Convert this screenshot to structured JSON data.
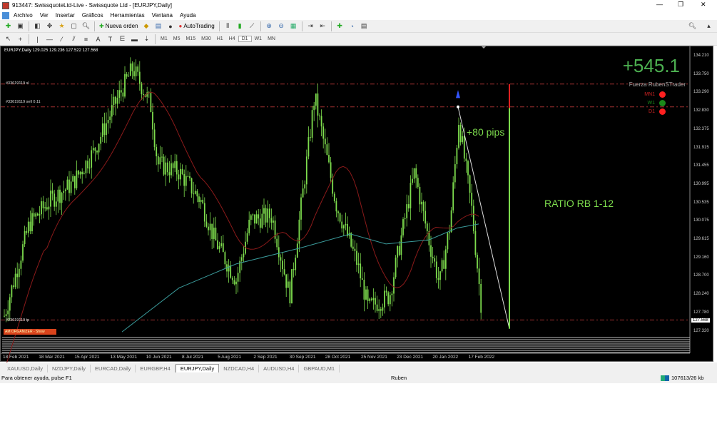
{
  "window": {
    "title": "913447: SwissquoteLtd-Live - Swissquote Ltd - [EURJPY,Daily]",
    "minimize": "—",
    "maximize": "❐",
    "close": "✕"
  },
  "menu": [
    "Archivo",
    "Ver",
    "Insertar",
    "Gráficos",
    "Herramientas",
    "Ventana",
    "Ayuda"
  ],
  "toolbar": {
    "new_order": "Nueva orden",
    "autotrading": "AutoTrading",
    "timeframes": [
      "M1",
      "M5",
      "M15",
      "M30",
      "H1",
      "H4",
      "D1",
      "W1",
      "MN"
    ],
    "active_timeframe": "D1"
  },
  "chart": {
    "symbol_header": "EURJPY,Daily  129.025 129.236 127.522 127.568",
    "levels": {
      "sl": "#33619119 sl",
      "sell": "#33619119 sell 0.11",
      "tp": "#33619119 tp"
    },
    "profit": "+545.1",
    "indicator_title": "Fuerza RubenSTrader",
    "signals": [
      {
        "label": "MN1",
        "color": "#ff2020"
      },
      {
        "label": "W1",
        "color": "#1a8a1a"
      },
      {
        "label": "D1",
        "color": "#ff2020"
      }
    ],
    "pips_label": "+80 pips",
    "ratio_label": "RATIO RB 1-12",
    "organizer": "AM ORGANIZER - Show",
    "price_ticks": [
      "134.210",
      "133.750",
      "133.290",
      "132.830",
      "132.375",
      "131.915",
      "131.455",
      "130.995",
      "130.535",
      "130.075",
      "129.615",
      "129.160",
      "128.700",
      "128.240",
      "127.780",
      "127.320"
    ],
    "current_price": "127.568",
    "time_ticks": [
      "18 Feb 2021",
      "18 Mar 2021",
      "15 Apr 2021",
      "13 May 2021",
      "10 Jun 2021",
      "8 Jul 2021",
      "5 Aug 2021",
      "2 Sep 2021",
      "30 Sep 2021",
      "28 Oct 2021",
      "25 Nov 2021",
      "23 Dec 2021",
      "20 Jan 2022",
      "17 Feb 2022"
    ],
    "colors": {
      "candle": "#7ddc4d",
      "ma_slow": "#8b1a1a",
      "ma_long": "#3a9a9a",
      "level_line": "#a03030"
    }
  },
  "tabs": [
    "XAUUSD,Daily",
    "NZDJPY,Daily",
    "EURCAD,Daily",
    "EURGBP,H4",
    "EURJPY,Daily",
    "NZDCAD,H4",
    "AUDUSD,H4",
    "GBPAUD,M1"
  ],
  "active_tab": "EURJPY,Daily",
  "status": {
    "help": "Para obtener ayuda, pulse F1",
    "user": "Ruben",
    "traffic": "107613/26 kb"
  }
}
